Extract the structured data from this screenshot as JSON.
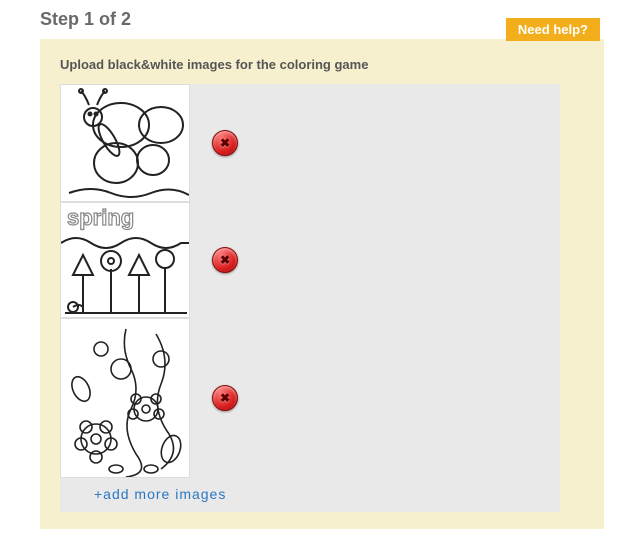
{
  "header": {
    "step_title": "Step 1 of 2",
    "help_label": "Need help?"
  },
  "panel": {
    "instruction": "Upload black&white images for the coloring game",
    "add_more_label": "+add more images",
    "delete_glyph": "✖",
    "thumbnails": [
      {
        "id": "butterfly"
      },
      {
        "id": "spring-flowers"
      },
      {
        "id": "floral-pattern"
      }
    ]
  }
}
